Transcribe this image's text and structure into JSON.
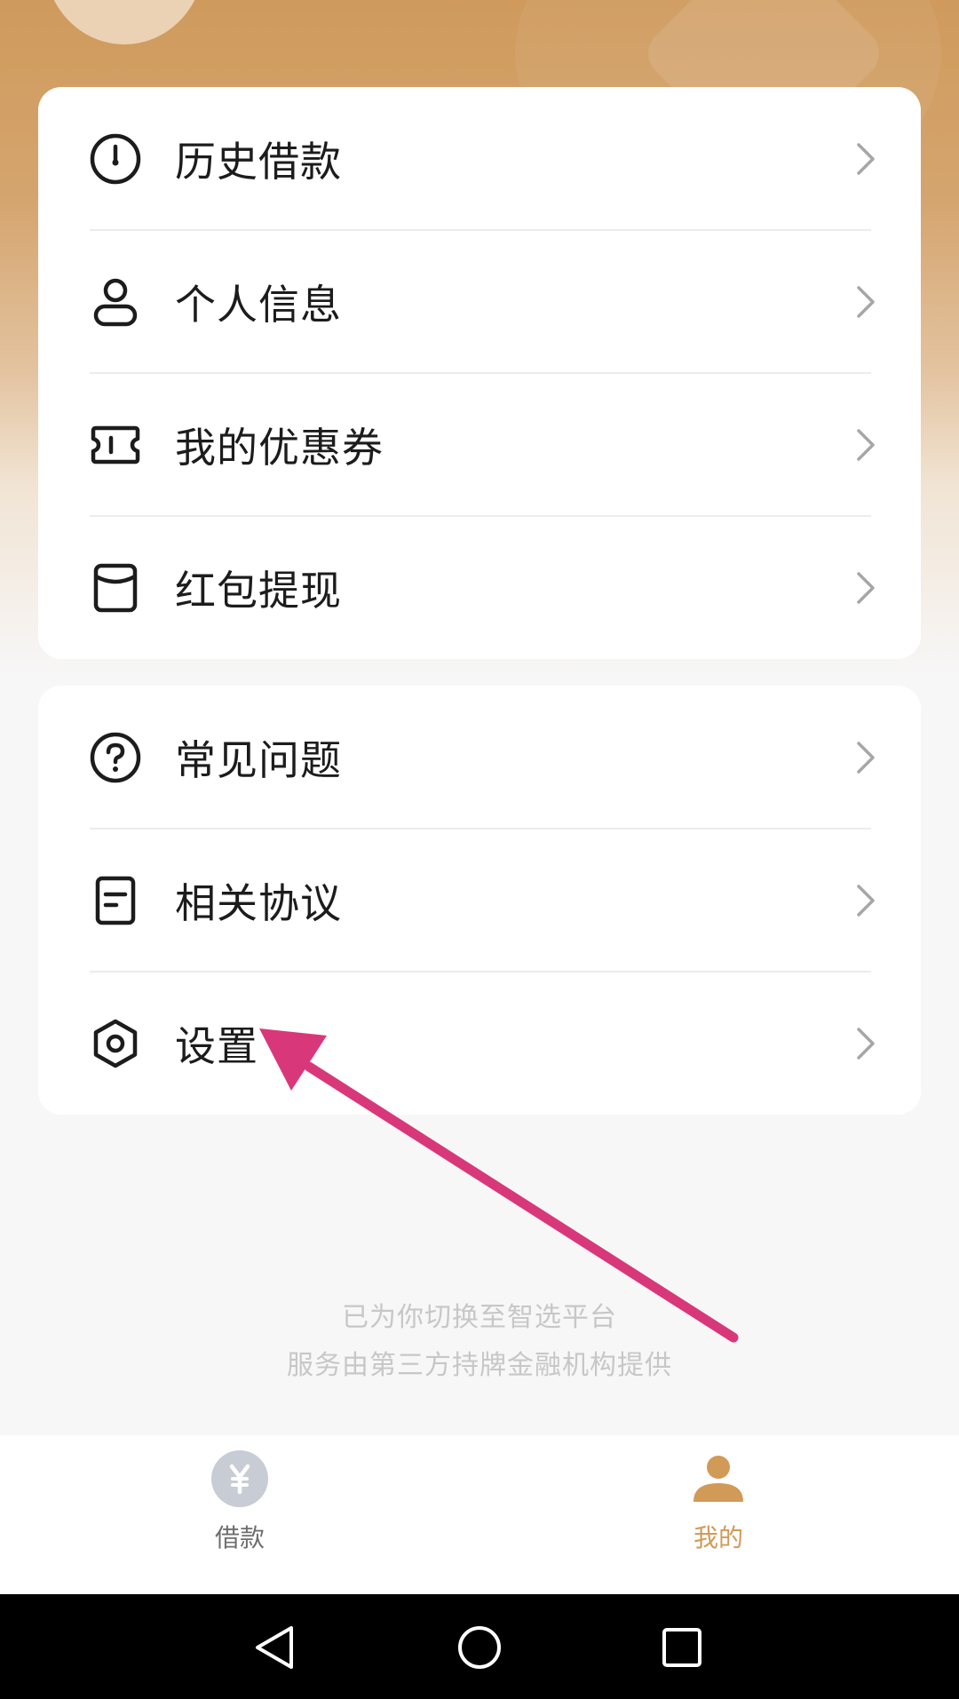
{
  "menu_groups": [
    {
      "items": [
        {
          "label": "历史借款",
          "icon": "clock-icon"
        },
        {
          "label": "个人信息",
          "icon": "person-icon"
        },
        {
          "label": "我的优惠券",
          "icon": "coupon-icon"
        },
        {
          "label": "红包提现",
          "icon": "red-envelope-icon"
        }
      ]
    },
    {
      "items": [
        {
          "label": "常见问题",
          "icon": "question-icon"
        },
        {
          "label": "相关协议",
          "icon": "document-icon"
        },
        {
          "label": "设置",
          "icon": "settings-icon"
        }
      ]
    }
  ],
  "notice": {
    "line1": "已为你切换至智选平台",
    "line2": "服务由第三方持牌金融机构提供"
  },
  "tabbar": {
    "tabs": [
      {
        "label": "借款",
        "icon": "yen-icon",
        "active": false
      },
      {
        "label": "我的",
        "icon": "user-icon",
        "active": true
      }
    ]
  },
  "colors": {
    "accent": "#d29a57",
    "inactive_tab": "#c8ccd5",
    "header_gradient_top": "#cf9a5c",
    "annotation_arrow": "#d8387a"
  },
  "system_nav": {
    "icons": [
      "back-icon",
      "home-icon",
      "recents-icon"
    ]
  }
}
